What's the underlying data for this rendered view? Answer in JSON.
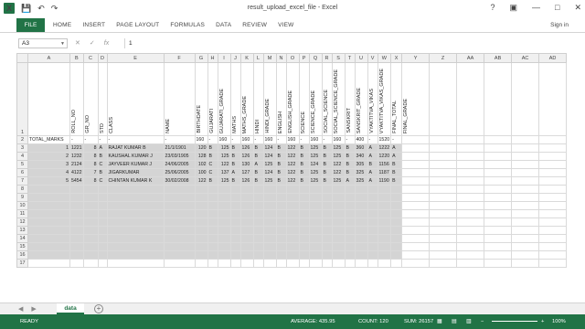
{
  "window": {
    "title": "result_upload_excel_file - Excel"
  },
  "qat": {
    "save": "💾",
    "undo": "↶",
    "redo": "↷",
    "logo": "X"
  },
  "controls": {
    "help": "?",
    "ribbon": "▣",
    "minimize": "—",
    "maximize": "□",
    "close": "✕"
  },
  "ribbon": {
    "file": "FILE",
    "tabs": [
      "HOME",
      "INSERT",
      "PAGE LAYOUT",
      "FORMULAS",
      "DATA",
      "REVIEW",
      "VIEW"
    ],
    "signin": "Sign in"
  },
  "formula_bar": {
    "name_box": "A3",
    "cancel": "✕",
    "enter": "✓",
    "fx": "fx",
    "value": "1"
  },
  "columns": [
    "A",
    "B",
    "C",
    "D",
    "E",
    "F",
    "G",
    "H",
    "I",
    "J",
    "K",
    "L",
    "M",
    "N",
    "O",
    "P",
    "Q",
    "R",
    "S",
    "T",
    "U",
    "V",
    "W",
    "X",
    "Y",
    "Z",
    "AA",
    "AB",
    "AC",
    "AD"
  ],
  "header_row": {
    "B": "ROLL_NO",
    "C": "GR_NO",
    "D": "STD",
    "E": "CLASS",
    "F": "NAME",
    "G": "BIRTHDATE",
    "H": "GUJARATI",
    "I": "GUJARATI_GRADE",
    "J": "MATHS",
    "K": "MATHS_GRADE",
    "L": "HINDI",
    "M": "HINDI_GRADE",
    "N": "ENGLISH",
    "O": "ENGLISH_GRADE",
    "P": "SCIENCE",
    "Q": "SCIENCE_GRADE",
    "R": "SOCIAL_SCIENCE",
    "S": "SOCIAL_SCIENCE_GRADE",
    "T": "SANSKRIT",
    "U": "SANSKRIT_GRADE",
    "V": "VYAKTITVA_VIKAS",
    "W": "VYAKTITVA_VIKAS_GRADE",
    "X": "FINAL_TOTAL",
    "Y": "FINAL_GRADE"
  },
  "total_marks_row": [
    "TOTAL_MARKS",
    "-",
    "-",
    "-",
    "-",
    "-",
    "160",
    "-",
    "160",
    "-",
    "160",
    "-",
    "160",
    "-",
    "160",
    "-",
    "160",
    "-",
    "160",
    "-",
    "400",
    "-",
    "1520",
    "-"
  ],
  "data_rows": [
    [
      "1",
      "1221",
      "8",
      "A",
      "RAJAT KUMAR B",
      "21/1/1901",
      "120",
      "B",
      "125",
      "B",
      "126",
      "B",
      "124",
      "B",
      "122",
      "B",
      "125",
      "B",
      "125",
      "B",
      "360",
      "A",
      "1222",
      "A"
    ],
    [
      "2",
      "1232",
      "8",
      "B",
      "KAUSHAL KUMAR J",
      "23/03/1905",
      "128",
      "B",
      "125",
      "B",
      "126",
      "B",
      "124",
      "B",
      "122",
      "B",
      "125",
      "B",
      "125",
      "B",
      "340",
      "A",
      "1220",
      "A"
    ],
    [
      "3",
      "2124",
      "8",
      "C",
      "JAYVEER KUMAR J",
      "24/06/2005",
      "102",
      "C",
      "122",
      "B",
      "130",
      "A",
      "125",
      "B",
      "122",
      "B",
      "124",
      "B",
      "122",
      "B",
      "305",
      "B",
      "1156",
      "B"
    ],
    [
      "4",
      "4122",
      "7",
      "B",
      "JIGARKUMAR",
      "25/06/2005",
      "100",
      "C",
      "137",
      "A",
      "127",
      "B",
      "124",
      "B",
      "122",
      "B",
      "125",
      "B",
      "122",
      "B",
      "325",
      "A",
      "1187",
      "B"
    ],
    [
      "5",
      "5454",
      "8",
      "C",
      "CHINTAN KUMAR K",
      "30/02/2008",
      "122",
      "B",
      "125",
      "B",
      "126",
      "B",
      "125",
      "B",
      "122",
      "B",
      "125",
      "B",
      "125",
      "A",
      "325",
      "A",
      "1190",
      "B"
    ]
  ],
  "row_numbers": [
    "1",
    "2",
    "3",
    "4",
    "5",
    "6",
    "7",
    "8",
    "9",
    "10",
    "11",
    "12",
    "13",
    "14",
    "15",
    "16",
    "17"
  ],
  "sheet_tabs": {
    "active": "data",
    "add": "+",
    "prev": "◀",
    "next": "▶"
  },
  "status": {
    "ready": "READY",
    "average": "AVERAGE: 435.95",
    "count": "COUNT: 120",
    "sum": "SUM: 26157",
    "zoom": "100%"
  },
  "colors": {
    "accent": "#217346",
    "selection": "#d4d4d4"
  }
}
